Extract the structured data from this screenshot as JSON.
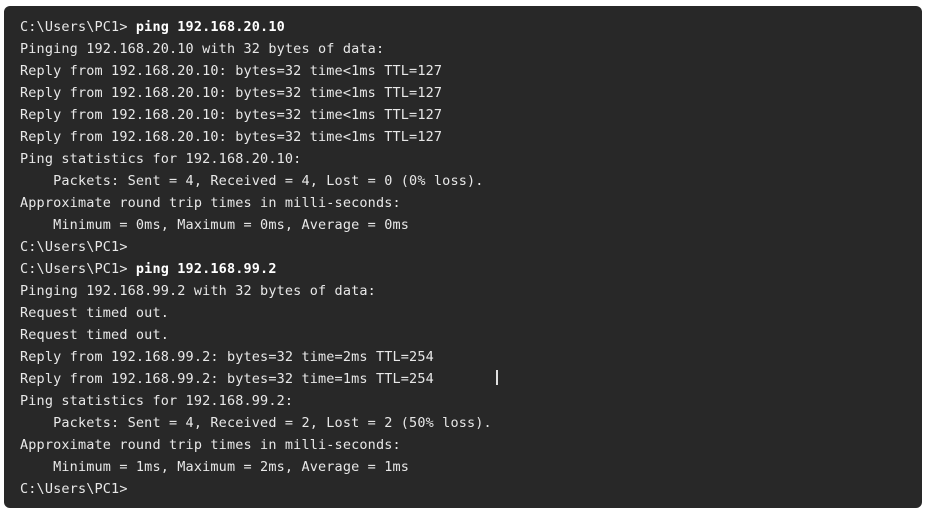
{
  "terminal": {
    "background": "#282828",
    "text_color": "#e8e8e8",
    "lines": [
      {
        "prompt": "C:\\Users\\PC1> ",
        "command": "ping 192.168.20.10"
      },
      {
        "text": "Pinging 192.168.20.10 with 32 bytes of data:"
      },
      {
        "text": "Reply from 192.168.20.10: bytes=32 time<1ms TTL=127"
      },
      {
        "text": "Reply from 192.168.20.10: bytes=32 time<1ms TTL=127"
      },
      {
        "text": "Reply from 192.168.20.10: bytes=32 time<1ms TTL=127"
      },
      {
        "text": "Reply from 192.168.20.10: bytes=32 time<1ms TTL=127"
      },
      {
        "text": "Ping statistics for 192.168.20.10:"
      },
      {
        "text": "    Packets: Sent = 4, Received = 4, Lost = 0 (0% loss)."
      },
      {
        "text": "Approximate round trip times in milli-seconds:"
      },
      {
        "text": "    Minimum = 0ms, Maximum = 0ms, Average = 0ms"
      },
      {
        "text": "C:\\Users\\PC1>"
      },
      {
        "prompt": "C:\\Users\\PC1> ",
        "command": "ping 192.168.99.2"
      },
      {
        "text": "Pinging 192.168.99.2 with 32 bytes of data:"
      },
      {
        "text": "Request timed out."
      },
      {
        "text": "Request timed out."
      },
      {
        "text": "Reply from 192.168.99.2: bytes=32 time=2ms TTL=254"
      },
      {
        "text": "Reply from 192.168.99.2: bytes=32 time=1ms TTL=254"
      },
      {
        "text": "Ping statistics for 192.168.99.2:"
      },
      {
        "text": "    Packets: Sent = 4, Received = 2, Lost = 2 (50% loss)."
      },
      {
        "text": "Approximate round trip times in milli-seconds:"
      },
      {
        "text": "    Minimum = 1ms, Maximum = 2ms, Average = 1ms"
      },
      {
        "text": "C:\\Users\\PC1>"
      }
    ]
  }
}
